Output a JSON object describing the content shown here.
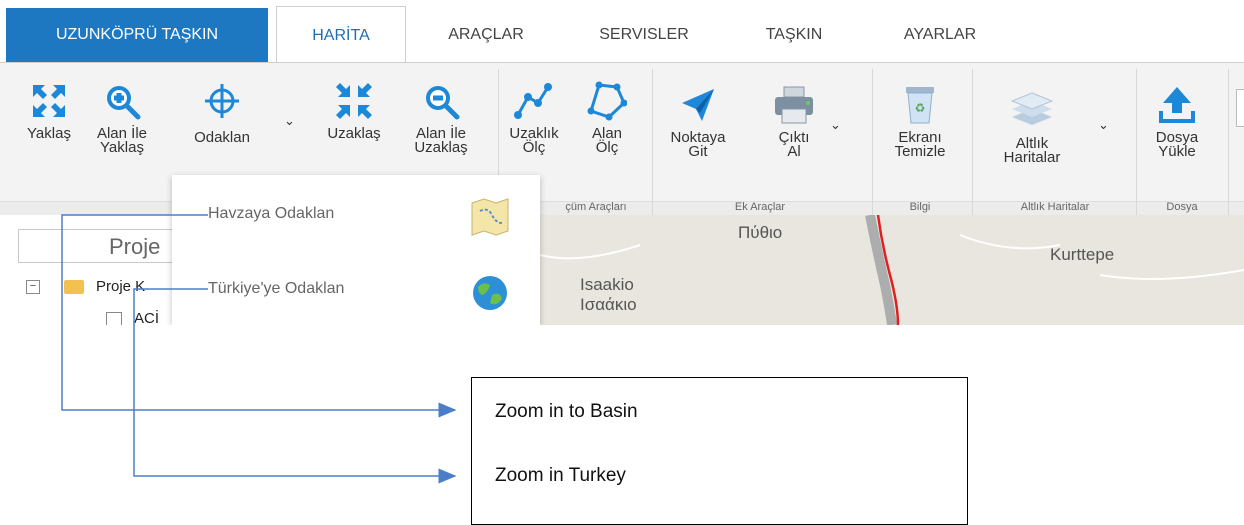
{
  "tabs": {
    "app": "UZUNKÖPRÜ TAŞKIN",
    "items": [
      "HARİTA",
      "ARAÇLAR",
      "SERVISLER",
      "TAŞKIN",
      "AYARLAR"
    ]
  },
  "ribbon": {
    "buttons": {
      "zoom_in": "Yaklaş",
      "area_zoom_in_1": "Alan İle",
      "area_zoom_in_2": "Yaklaş",
      "focus": "Odaklan",
      "zoom_out": "Uzaklaş",
      "area_zoom_out_1": "Alan İle",
      "area_zoom_out_2": "Uzaklaş",
      "measure_distance_1": "Uzaklık",
      "measure_distance_2": "Ölç",
      "measure_area_1": "Alan",
      "measure_area_2": "Ölç",
      "goto_point_1": "Noktaya",
      "goto_point_2": "Git",
      "print_1": "Çıktı",
      "print_2": "Al",
      "clear_1": "Ekranı",
      "clear_2": "Temizle",
      "basemaps_1": "Altlık",
      "basemaps_2": "Haritalar",
      "upload_1": "Dosya",
      "upload_2": "Yükle"
    },
    "groups": {
      "measure": "çüm Araçları",
      "extra": "Ek Araçlar",
      "info": "Bilgi",
      "basemaps": "Altlık Haritalar",
      "file": "Dosya"
    }
  },
  "dropdown": {
    "items": [
      "Havzaya Odaklan",
      "Türkiye'ye Odaklan"
    ]
  },
  "panel": {
    "header": "Proje",
    "tree_root": "Proje K",
    "tree_child": "ACİ"
  },
  "map": {
    "labels": [
      "Πύθιο",
      "Kurttepe",
      "Isaakio",
      "Ισαάκιο"
    ]
  },
  "annotation": {
    "lines": [
      "Zoom in to Basin",
      "Zoom in Turkey"
    ]
  },
  "colors": {
    "accent": "#1d78c1",
    "icon_blue": "#1e88d8",
    "arrow": "#4a7ec8"
  }
}
